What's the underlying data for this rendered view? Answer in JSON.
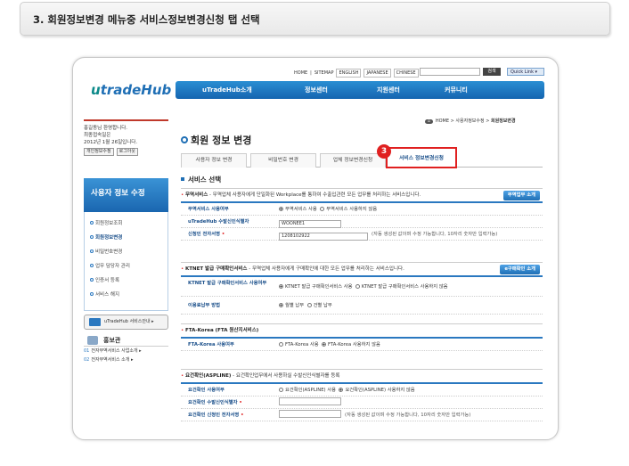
{
  "step_header": "3. 회원정보변경 메뉴중 서비스정보변경신청 탭 선택",
  "top_links": {
    "home": "HOME",
    "sitemap": "SITEMAP",
    "english": "ENGLISH",
    "japanese": "JAPANESE",
    "chinese": "CHINESE",
    "search_button": "검색",
    "quick_link": "Quick Link"
  },
  "logo": {
    "u": "u",
    "rest": "tradeHub"
  },
  "gnb": [
    "uTradeHub소개",
    "정보센터",
    "지원센터",
    "커뮤니티"
  ],
  "login": {
    "line1": "홍길동님 환영합니다.",
    "line2": "최종접속일은",
    "line3": "2012년 1월 26일입니다.",
    "personal_info_btn": "개인정보수정",
    "logout_btn": "로그아웃"
  },
  "lnb": {
    "title": "사용자 정보 수정",
    "items": [
      "회원정보조회",
      "회원정보변경",
      "비밀번호변경",
      "업무 담당자 관리",
      "인증서 등록",
      "서비스 해지"
    ],
    "active_index": 1
  },
  "guide_button": "uTradeHub 서비스안내",
  "pr": {
    "title": "홍보관",
    "items": [
      {
        "num": "01",
        "label": "전자무역서비스 사업소개"
      },
      {
        "num": "02",
        "label": "전자무역서비스 소개"
      }
    ]
  },
  "breadcrumb": {
    "home": "HOME",
    "level1": "사용자정보수정",
    "level2": "회원정보변경"
  },
  "page_title": "회원 정보 변경",
  "tabs": [
    "사용자 정보 변경",
    "비밀번호 변경",
    "업체 정보변경신청",
    "서비스 정보변경신청"
  ],
  "active_tab": 3,
  "step_badge": "3",
  "section_title": "서비스 선택",
  "blocks": {
    "trade": {
      "head_title": "무역서비스",
      "head_desc": " - 무역업체 사용자에게 단일화된 Workplace를 통하여 수출입관련 모든 업무를 처리하는 서비스입니다.",
      "button": "무역업무 소개",
      "rows": {
        "use_label": "무역서비스 사용여부",
        "use_opt1": "무역서비스 사용",
        "use_opt2": "무역서비스 사용하지 않음",
        "id_label": "uTradeHub 수발신인식별자",
        "id_value": "WOONEE1",
        "sign_label": "신청인 전자서명",
        "sign_value": "1208102922",
        "sign_note": "(자동 생성된 값이며 수정 가능합니다, 10자리 숫자만 입력가능)"
      }
    },
    "ktnet": {
      "head_title": "KTNET 발급 구매확인서비스",
      "head_desc": " - 무역업체 사용자에게 구매확인에 대한 모든 업무를 처리하는 서비스입니다.",
      "button": "e구매확인 소개",
      "rows": {
        "use_label": "KTNET 발급 구매확인서비스 사용여부",
        "use_opt1": "KTNET 발급 구매확인서비스 사용",
        "use_opt2": "KTNET 발급 구매확인서비스 사용하지 않음",
        "pay_label": "이용료납부 방법",
        "pay_opt1": "월별 납부",
        "pay_opt2": "건별 납부"
      }
    },
    "fta": {
      "head_title": "FTA-Korea (FTA 원산지서비스)",
      "rows": {
        "use_label": "FTA-Korea 사용여부",
        "use_opt1": "FTA-Korea 사용",
        "use_opt2": "FTA-Korea 사용하지 않음"
      }
    },
    "aspline": {
      "head_title": "요건확인(ASPLINE)",
      "head_desc": " - 요건확인업무에서 사용하실 수발신인식별자를 등록",
      "rows": {
        "use_label": "요건확인 사용여부",
        "use_opt1": "요건확인(ASPLINE) 사용",
        "use_opt2": "요건확인(ASPLINE) 사용하지 않음",
        "id_label": "요건확인 수발신인식별자",
        "sign_label": "요건확인 신청인 전자서명",
        "sign_note": "(자동 생성된 값이며 수정 가능합니다, 10자리 숫자만 입력가능)"
      }
    }
  }
}
